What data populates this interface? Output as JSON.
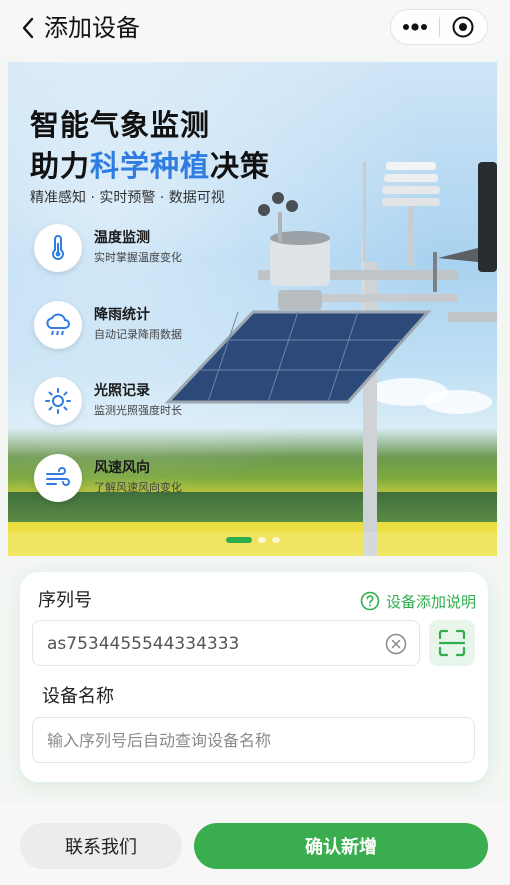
{
  "nav": {
    "title": "添加设备",
    "back_icon": "chevron-left-icon",
    "more_icon": "more-dots-icon",
    "close_icon": "target-circle-icon"
  },
  "banner": {
    "title_line1": "智能气象监测",
    "title_line2_prefix": "助力",
    "title_line2_highlight": "科学种植",
    "title_line2_suffix": "决策",
    "subtitle": "精准感知 · 实时预警 · 数据可视",
    "highlight_color": "#2f7de1",
    "features": [
      {
        "icon": "thermometer-icon",
        "title": "温度监测",
        "desc": "实时掌握温度变化"
      },
      {
        "icon": "rain-cloud-icon",
        "title": "降雨统计",
        "desc": "自动记录降雨数据"
      },
      {
        "icon": "sun-icon",
        "title": "光照记录",
        "desc": "监测光照强度时长"
      },
      {
        "icon": "wind-icon",
        "title": "风速风向",
        "desc": "了解风速风向变化"
      }
    ],
    "carousel_count": 3,
    "carousel_active": 1
  },
  "form": {
    "serial_label": "序列号",
    "help_link": "设备添加说明",
    "serial_value": "as7534455544334333",
    "name_label": "设备名称",
    "name_placeholder": "输入序列号后自动查询设备名称"
  },
  "actions": {
    "contact": "联系我们",
    "confirm": "确认新增"
  },
  "colors": {
    "accent": "#3aad4f",
    "accent_light": "#e8f5ea"
  }
}
